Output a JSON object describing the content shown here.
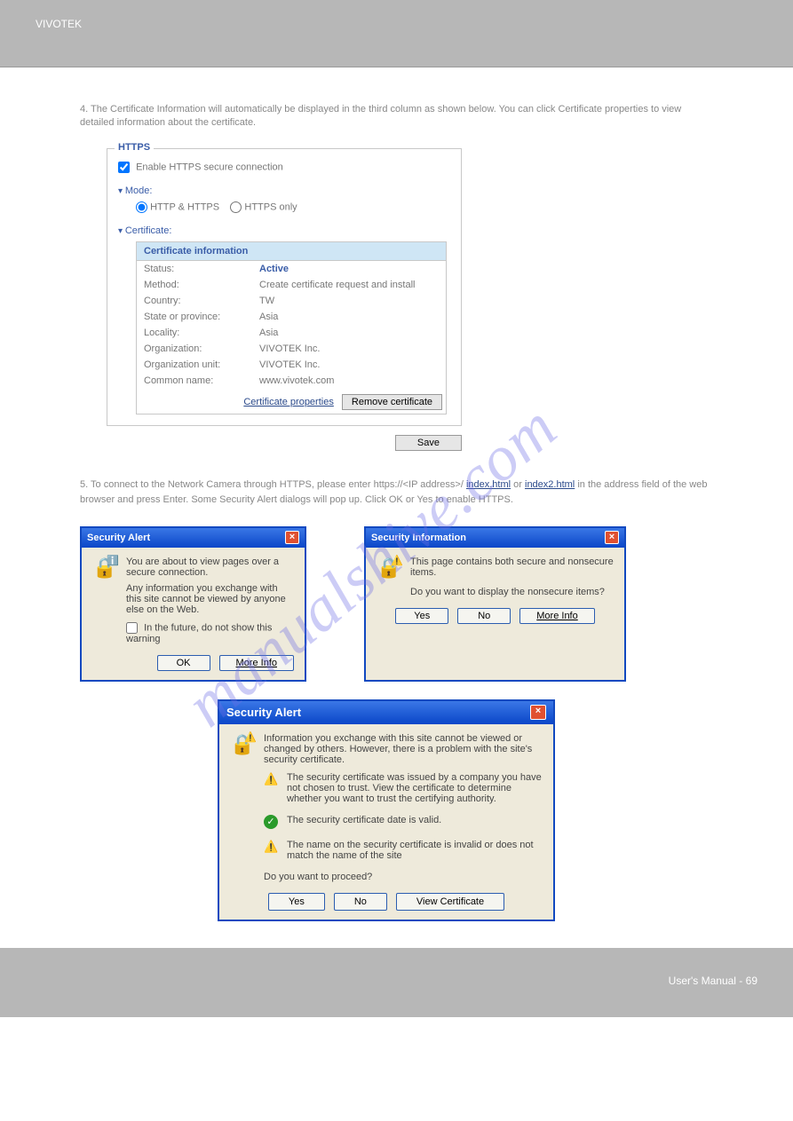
{
  "header": {
    "left": "VIVOTEK",
    "right": ""
  },
  "footer": {
    "left": "",
    "right": "User's Manual - 69"
  },
  "intro": "4. The Certificate Information will automatically be displayed in the third column as shown below. You can click Certificate properties to view detailed information about the certificate.",
  "httpsPanel": {
    "legend": "HTTPS",
    "enableLabel": "Enable HTTPS secure connection",
    "modeLabel": "Mode:",
    "modeOptions": {
      "http_https": "HTTP & HTTPS",
      "https_only": "HTTPS only"
    },
    "certLabel": "Certificate:",
    "certHeader": "Certificate information",
    "rows": [
      {
        "k": "Status:",
        "v": "Active",
        "active": true
      },
      {
        "k": "Method:",
        "v": "Create certificate request and install"
      },
      {
        "k": "Country:",
        "v": "TW"
      },
      {
        "k": "State or province:",
        "v": "Asia"
      },
      {
        "k": "Locality:",
        "v": "Asia"
      },
      {
        "k": "Organization:",
        "v": "VIVOTEK Inc."
      },
      {
        "k": "Organization unit:",
        "v": "VIVOTEK Inc."
      },
      {
        "k": "Common name:",
        "v": "www.vivotek.com"
      }
    ],
    "certPropsLink": "Certificate properties",
    "removeBtn": "Remove certificate",
    "saveBtn": "Save"
  },
  "step": {
    "prefix": "5. To connect to the Network Camera through HTTPS, please enter https://<IP address>/",
    "link1": "index.html",
    "mid": " or ",
    "link2": "index2.html",
    "suffix": " in the address field of the web browser and press Enter. Some Security Alert dialogs will pop up. Click OK or Yes to enable HTTPS."
  },
  "dialog1": {
    "title": "Security Alert",
    "line1": "You are about to view pages over a secure connection.",
    "line2": "Any information you exchange with this site cannot be viewed by anyone else on the Web.",
    "checkbox": "In the future, do not show this warning",
    "ok": "OK",
    "moreInfo": "More Info"
  },
  "dialog2": {
    "title": "Security Information",
    "line1": "This page contains both secure and nonsecure items.",
    "line2": "Do you want to display the nonsecure items?",
    "yes": "Yes",
    "no": "No",
    "moreInfo": "More Info"
  },
  "dialog3": {
    "title": "Security Alert",
    "intro": "Information you exchange with this site cannot be viewed or changed by others. However, there is a problem with the site's security certificate.",
    "item1": "The security certificate was issued by a company you have not chosen to trust. View the certificate to determine whether you want to trust the certifying authority.",
    "item2": "The security certificate date is valid.",
    "item3": "The name on the security certificate is invalid or does not match the name of the site",
    "proceed": "Do you want to proceed?",
    "yes": "Yes",
    "no": "No",
    "viewCert": "View Certificate"
  },
  "watermark": "manualshive.com"
}
